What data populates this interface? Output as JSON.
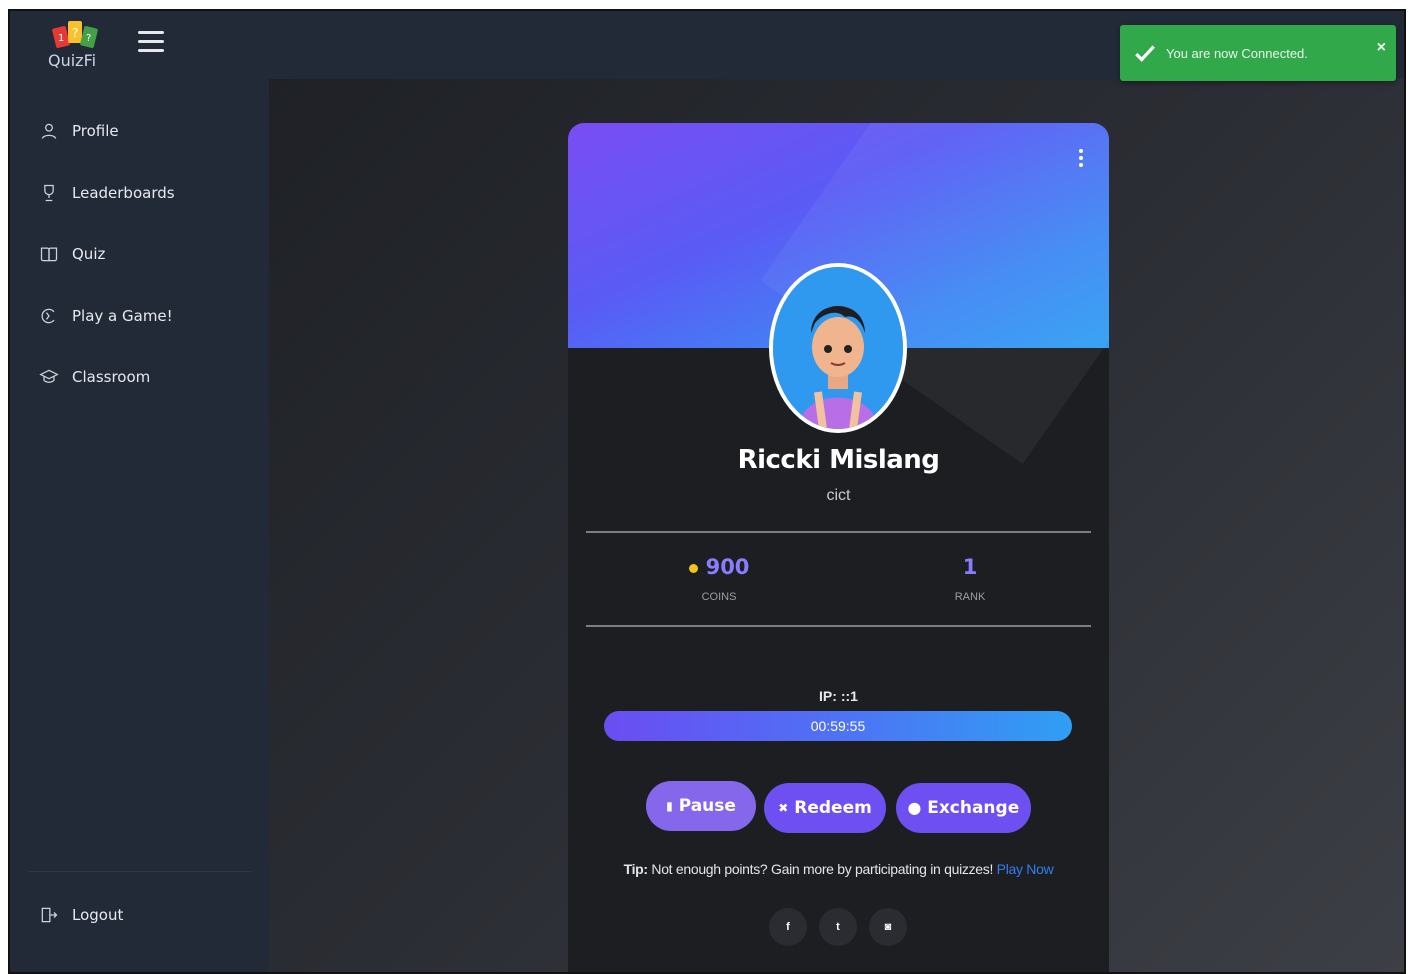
{
  "app": {
    "logo_text": "QuizFi"
  },
  "sidebar": {
    "items": [
      {
        "label": "Profile",
        "icon": "user-icon"
      },
      {
        "label": "Leaderboards",
        "icon": "trophy-icon"
      },
      {
        "label": "Quiz",
        "icon": "book-icon"
      },
      {
        "label": "Play a Game!",
        "icon": "game-icon"
      },
      {
        "label": "Classroom",
        "icon": "classroom-icon"
      }
    ],
    "logout": {
      "label": "Logout",
      "icon": "logout-icon"
    }
  },
  "toast": {
    "message": "You are now Connected.",
    "close": "×",
    "color": "#31a84a"
  },
  "profile": {
    "name": "Riccki Mislang",
    "department": "cict",
    "coins": "900",
    "coins_label": "COINS",
    "rank": "1",
    "rank_label": "RANK",
    "ip": "IP: ::1",
    "timer": "00:59:55"
  },
  "actions": {
    "pause": "Pause",
    "redeem": "Redeem",
    "exchange": "Exchange"
  },
  "tip": {
    "prefix": "Tip:",
    "text": "Not enough points? Gain more by participating in quizzes!",
    "link": "Play Now"
  },
  "social": {
    "facebook": "f",
    "twitter": "t",
    "instagram": "◙"
  },
  "colors": {
    "accent": "#6e4ff2",
    "value": "#8b7cff",
    "link": "#2f7df5",
    "sidebar": "#222a38"
  }
}
